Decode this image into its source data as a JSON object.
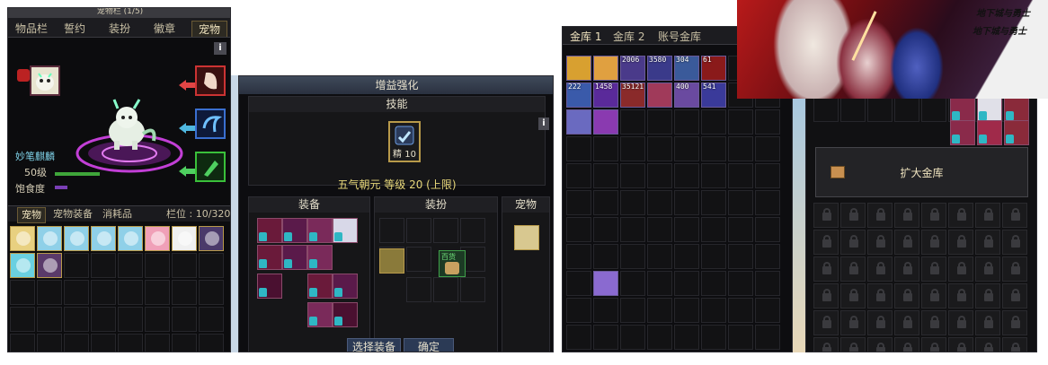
{
  "pet_panel": {
    "title": "宠物栏 (1/5)",
    "tabs": [
      "物品栏",
      "誓约",
      "装扮",
      "徽章",
      "宠物"
    ],
    "active_tab": "宠物",
    "info_label": "i",
    "pet_name": "妙笔麒麟",
    "level": "50级",
    "satiety_label": "饱食度",
    "inventory_tabs": [
      "宠物",
      "宠物装备",
      "消耗品"
    ],
    "slot_count": "栏位 : 10/320"
  },
  "enhance_panel": {
    "title": "增益强化",
    "skill_section": "技能",
    "skill_level_badge": "精 10",
    "skill_line": "五气朝元 等级 20 (上限)",
    "equip_section": "装备",
    "avatar_section": "装扮",
    "pet_section": "宠物",
    "avatar_badge": "百货",
    "select_button": "选择装备",
    "confirm_button": "确定",
    "info_label": "i"
  },
  "vault_panel": {
    "tabs": [
      "金库 1",
      "金库 2",
      "账号金库"
    ],
    "active_tab": "金库 1",
    "counts": [
      "2006",
      "3580",
      "304",
      "61",
      "222",
      "1458",
      "35121",
      "400",
      "541"
    ]
  },
  "expand_panel": {
    "expand_button": "扩大金库"
  },
  "banner": {
    "logo_text": "地下城与勇士"
  },
  "colors": {
    "accent_gold": "#e8d87a",
    "exp_bar": "#3fa63a",
    "satiety_bar": "#7a3fb5",
    "pet_name": "#7fd2e8"
  }
}
